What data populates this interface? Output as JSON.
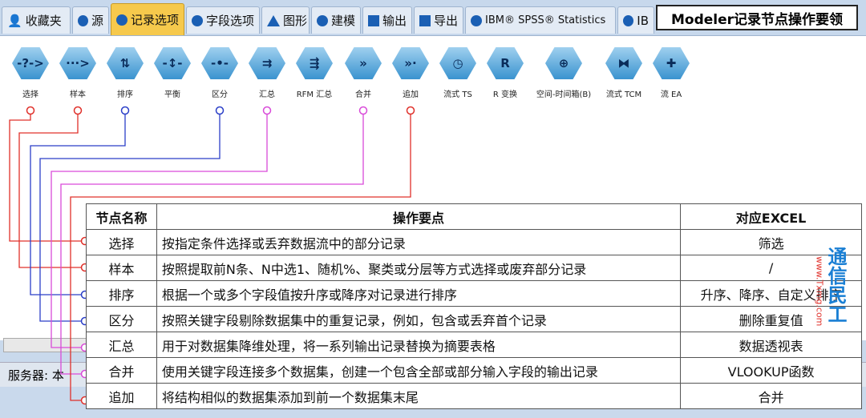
{
  "tabs": [
    {
      "label": "收藏夹",
      "icon": "favorites-icon"
    },
    {
      "label": "源",
      "icon": "source-icon"
    },
    {
      "label": "记录选项",
      "icon": "record-ops-icon",
      "active": true
    },
    {
      "label": "字段选项",
      "icon": "field-ops-icon"
    },
    {
      "label": "图形",
      "icon": "graph-icon"
    },
    {
      "label": "建模",
      "icon": "modeling-icon"
    },
    {
      "label": "输出",
      "icon": "output-icon"
    },
    {
      "label": "导出",
      "icon": "export-icon"
    },
    {
      "label": "IBM® SPSS® Statistics",
      "icon": "spss-icon"
    },
    {
      "label": "IB",
      "icon": "ibm-icon"
    }
  ],
  "title": "Modeler记录节点操作要领",
  "nodes": [
    {
      "label": "选择",
      "glyph": "-?->"
    },
    {
      "label": "样本",
      "glyph": "···>"
    },
    {
      "label": "排序",
      "glyph": "⇅"
    },
    {
      "label": "平衡",
      "glyph": "-↕-"
    },
    {
      "label": "区分",
      "glyph": "-•-"
    },
    {
      "label": "汇总",
      "glyph": "⇉"
    },
    {
      "label": "RFM 汇总",
      "glyph": "⇶"
    },
    {
      "label": "合并",
      "glyph": "»"
    },
    {
      "label": "追加",
      "glyph": "»·"
    },
    {
      "label": "流式 TS",
      "glyph": "◷"
    },
    {
      "label": "R 变换",
      "glyph": "R"
    },
    {
      "label": "空间-时间箱(B)",
      "glyph": "⊕"
    },
    {
      "label": "流式 TCM",
      "glyph": "⧓"
    },
    {
      "label": "流 EA",
      "glyph": "✚"
    }
  ],
  "status": {
    "server_label": "服务器: 本"
  },
  "table": {
    "headers": [
      "节点名称",
      "操作要点",
      "对应EXCEL"
    ],
    "rows": [
      [
        "选择",
        "按指定条件选择或丢弃数据流中的部分记录",
        "筛选"
      ],
      [
        "样本",
        "按照提取前N条、N中选1、随机%、聚类或分层等方式选择或废弃部分记录",
        "/"
      ],
      [
        "排序",
        "根据一个或多个字段值按升序或降序对记录进行排序",
        "升序、降序、自定义排序"
      ],
      [
        "区分",
        "按照关键字段剔除数据集中的重复记录，例如，包含或丢弃首个记录",
        "删除重复值"
      ],
      [
        "汇总",
        "用于对数据集降维处理，将一系列输出记录替换为摘要表格",
        "数据透视表"
      ],
      [
        "合并",
        "使用关键字段连接多个数据集，创建一个包含全部或部分输入字段的输出记录",
        "VLOOKUP函数"
      ],
      [
        "追加",
        "将结构相似的数据集添加到前一个数据集末尾",
        "合并"
      ]
    ]
  },
  "connector_colors": [
    "#e0302a",
    "#e0302a",
    "#2b3fc8",
    "#2b3fc8",
    "#d94ad9",
    "#d94ad9",
    "#e0302a"
  ],
  "watermark": {
    "text": "通信民工",
    "url": "www.Txmg.com"
  }
}
